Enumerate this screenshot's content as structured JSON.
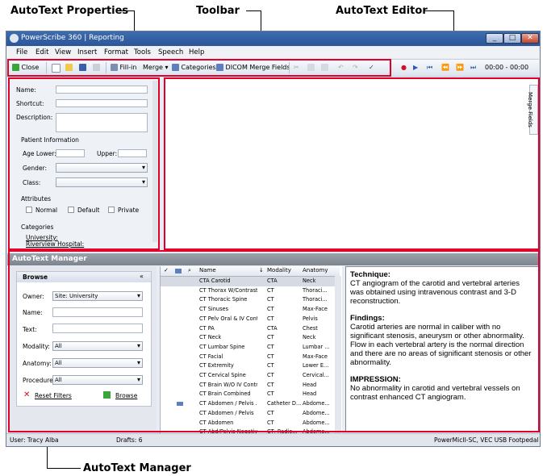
{
  "callouts": {
    "autotext_properties": "AutoText Properties",
    "toolbar": "Toolbar",
    "autotext_editor": "AutoText Editor",
    "autotext_manager": "AutoText Manager"
  },
  "window": {
    "title": "PowerScribe 360 | Reporting",
    "min": "_",
    "max": "□",
    "close": "✕"
  },
  "menu": [
    "File",
    "Edit",
    "View",
    "Insert",
    "Format",
    "Tools",
    "Speech",
    "Help"
  ],
  "toolbar": {
    "close": "Close",
    "fillin": "Fill-in",
    "merge": "Merge",
    "categories": "Categories",
    "dicom_merge_fields": "DICOM Merge Fields",
    "time": "00:00 - 00:00"
  },
  "properties": {
    "name_label": "Name:",
    "shortcut_label": "Shortcut:",
    "description_label": "Description:",
    "patient_info": "Patient Information",
    "age_lower": "Age Lower:",
    "upper": "Upper:",
    "gender": "Gender:",
    "class": "Class:",
    "attributes": "Attributes",
    "normal": "Normal",
    "default": "Default",
    "private": "Private",
    "categories": "Categories",
    "cat1": "University:",
    "cat2": "Riverview Hospital:"
  },
  "editor": {
    "merge_fields_tab": "Merge Fields"
  },
  "manager": {
    "title": "AutoText Manager",
    "browse": {
      "header": "Browse",
      "collapse": "«",
      "owner_label": "Owner:",
      "owner_value": "Site: University",
      "name_label": "Name:",
      "text_label": "Text:",
      "modality_label": "Modality:",
      "modality_value": "All",
      "anatomy_label": "Anatomy:",
      "anatomy_value": "All",
      "procedure_label": "Procedure:",
      "procedure_value": "All",
      "reset": "Reset Filters",
      "browse_btn": "Browse"
    },
    "grid": {
      "col_check": "✓",
      "col_name": "Name",
      "col_sort": "↓",
      "col_modality": "Modality",
      "col_anatomy": "Anatomy",
      "rows": [
        [
          "CTA Carotid",
          "CTA",
          "Neck"
        ],
        [
          "CT Thorax W/Contrast",
          "CT",
          "Thoraci..."
        ],
        [
          "CT Thoracic Spine",
          "CT",
          "Thoraci..."
        ],
        [
          "CT Sinuses",
          "CT",
          "Max-Face"
        ],
        [
          "CT Pelv Oral & IV Cont",
          "CT",
          "Pelvis"
        ],
        [
          "CT PA",
          "CTA",
          "Chest"
        ],
        [
          "CT Neck",
          "CT",
          "Neck"
        ],
        [
          "CT Lumbar Spine",
          "CT",
          "Lumbar ..."
        ],
        [
          "CT Facial",
          "CT",
          "Max-Face"
        ],
        [
          "CT Extremity",
          "CT",
          "Lower E..."
        ],
        [
          "CT Cervical Spine",
          "CT",
          "Cervical..."
        ],
        [
          "CT Brain W/O IV Contr...",
          "CT",
          "Head"
        ],
        [
          "CT Brain Combined",
          "CT",
          "Head"
        ],
        [
          "CT Abdomen / Pelvis ...",
          "Catheter D...",
          "Abdome..."
        ],
        [
          "CT Abdomen / Pelvis",
          "CT",
          "Abdome..."
        ],
        [
          "CT Abdomen",
          "CT",
          "Abdome..."
        ],
        [
          "CT Abd/Pelvis Negative...",
          "CT, Radio...",
          "Abdome..."
        ]
      ]
    },
    "preview": {
      "h1": "Technique:",
      "p1": "CT angiogram of the carotid and vertebral arteries was obtained using intravenous contrast and 3-D reconstruction.",
      "h2": "Findings:",
      "p2": "Carotid arteries are normal in caliber with no significant stenosis, aneurysm or other abnormality. Flow in each vertebral artery is the normal direction and there are no areas of significant stenosis or other abnormality.",
      "h3": "IMPRESSION:",
      "p3": "No abnormality in carotid and vertebral vessels on contrast enhanced CT angiogram."
    }
  },
  "status": {
    "user": "User: Tracy Alba",
    "drafts": "Drafts: 6",
    "device": "PowerMicII-SC, VEC USB Footpedal"
  },
  "colors": {
    "highlight": "#e2002a",
    "titlebar": "#2c5598"
  }
}
